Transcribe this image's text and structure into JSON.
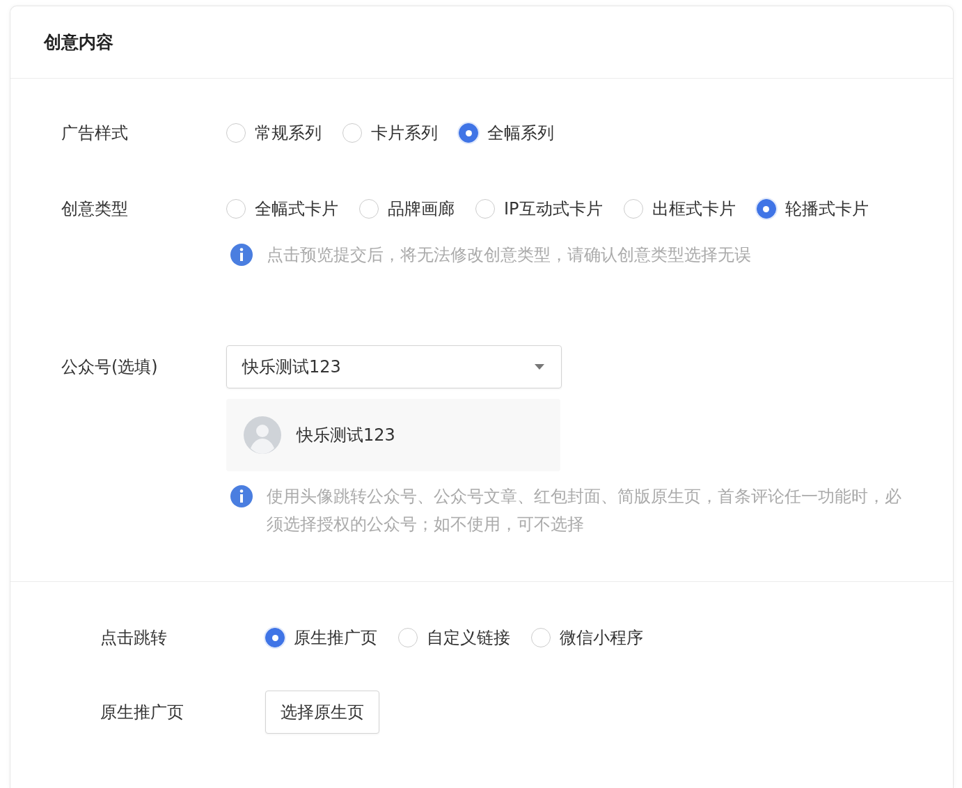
{
  "card": {
    "title": "创意内容"
  },
  "fields": [
    {
      "kind": "radio",
      "label": "广告样式",
      "options": [
        {
          "label": "常规系列",
          "selected": false
        },
        {
          "label": "卡片系列",
          "selected": false
        },
        {
          "label": "全幅系列",
          "selected": true
        }
      ]
    },
    {
      "kind": "radio",
      "label": "创意类型",
      "options": [
        {
          "label": "全幅式卡片",
          "selected": false
        },
        {
          "label": "品牌画廊",
          "selected": false
        },
        {
          "label": "IP互动式卡片",
          "selected": false
        },
        {
          "label": "出框式卡片",
          "selected": false
        },
        {
          "label": "轮播式卡片",
          "selected": true
        }
      ],
      "note": "点击预览提交后，将无法修改创意类型，请确认创意类型选择无误"
    },
    {
      "kind": "select",
      "label": "公众号(选填)",
      "value": "快乐测试123",
      "account": {
        "name": "快乐测试123"
      },
      "note": "使用头像跳转公众号、公众号文章、红包封面、简版原生页，首条评论任一功能时，必须选择授权的公众号；如不使用，可不选择"
    }
  ],
  "jump_section": {
    "fields": [
      {
        "kind": "radio",
        "label": "点击跳转",
        "options": [
          {
            "label": "原生推广页",
            "selected": true
          },
          {
            "label": "自定义链接",
            "selected": false
          },
          {
            "label": "微信小程序",
            "selected": false
          }
        ]
      },
      {
        "kind": "button",
        "label": "原生推广页",
        "button": "选择原生页"
      }
    ]
  }
}
